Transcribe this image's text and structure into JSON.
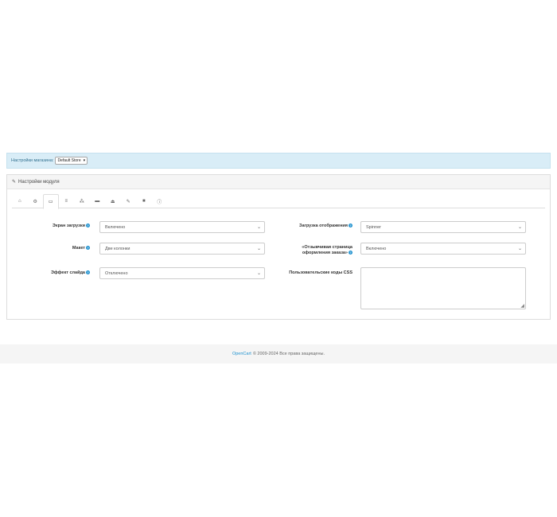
{
  "store_bar": {
    "label": "Настройки магазина:",
    "store_value": "Default Store"
  },
  "panel": {
    "title": "Настройки модуля",
    "tabs": [
      {
        "icon": "home-icon"
      },
      {
        "icon": "gear-icon"
      },
      {
        "icon": "desktop-icon"
      },
      {
        "icon": "list-icon"
      },
      {
        "icon": "sitemap-icon"
      },
      {
        "icon": "credit-card-icon"
      },
      {
        "icon": "bank-icon"
      },
      {
        "icon": "edit-icon"
      },
      {
        "icon": "truck-icon"
      },
      {
        "icon": "info-icon"
      }
    ],
    "fields": {
      "loading_screen": {
        "label": "Экран загрузки",
        "value": "Включено"
      },
      "layout": {
        "label": "Макет",
        "value": "Две колонки"
      },
      "slide_effect": {
        "label": "Эффект слайда",
        "value": "Отключено"
      },
      "display_loading": {
        "label": "Загрузка отображения",
        "value": "Spinner"
      },
      "responsive_checkout": {
        "label_line1": "«Отзывчивая страница",
        "label_line2": "оформления заказа»",
        "value": "Включено"
      },
      "custom_css": {
        "label": "Пользовательские коды CSS",
        "value": ""
      }
    }
  },
  "footer": {
    "link": "OpenCart",
    "text": "© 2009-2024 Все права защищены."
  },
  "colors": {
    "accent": "#1e91cf",
    "info_bar": "#d9edf7"
  }
}
